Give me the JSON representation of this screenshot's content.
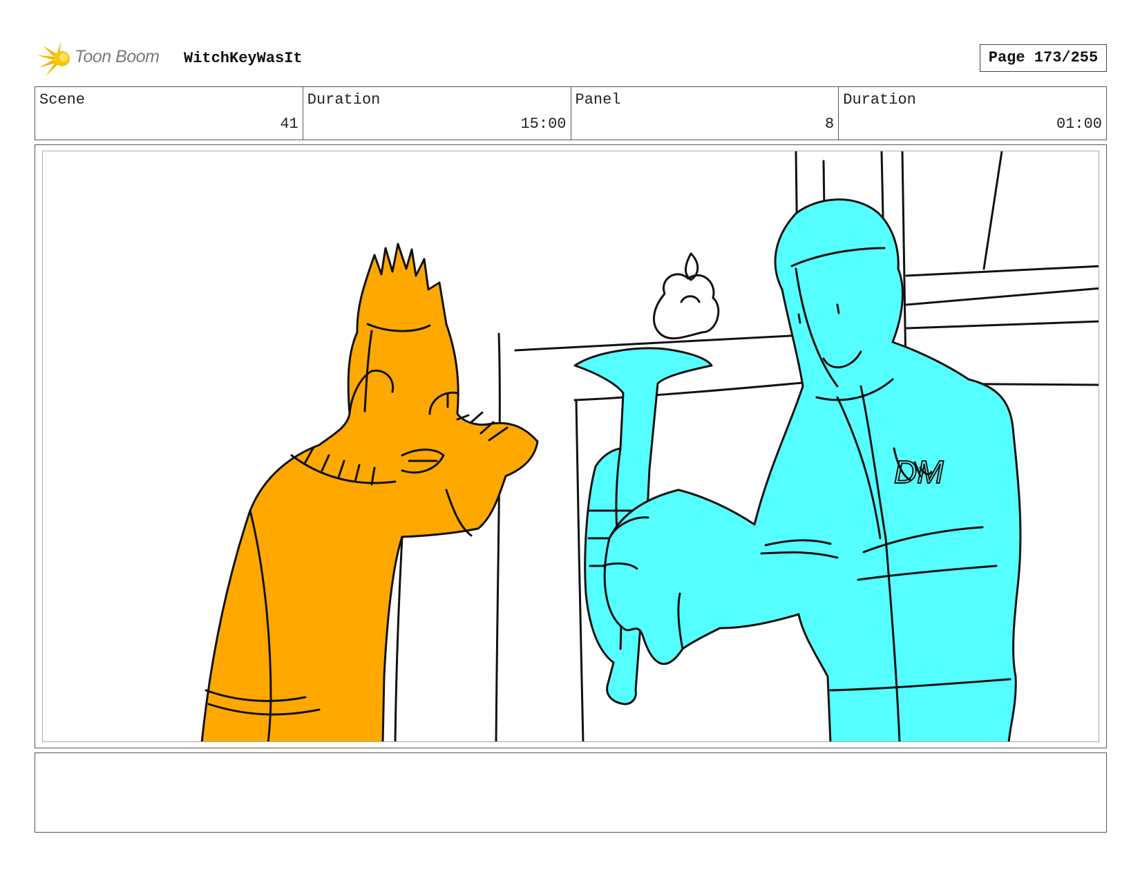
{
  "header": {
    "logo_text": "Toon Boom",
    "project_title": "WitchKeyWasIt",
    "page_label": "Page 173/255"
  },
  "info": {
    "scene_label": "Scene",
    "scene_value": "41",
    "scene_duration_label": "Duration",
    "scene_duration_value": "15:00",
    "panel_label": "Panel",
    "panel_value": "8",
    "panel_duration_label": "Duration",
    "panel_duration_value": "01:00"
  },
  "panel": {
    "sweater_logo_text": "DM",
    "colors": {
      "left_character": "#ffa800",
      "right_character": "#55ffff",
      "line": "#111111"
    }
  },
  "notes": {
    "text": ""
  }
}
